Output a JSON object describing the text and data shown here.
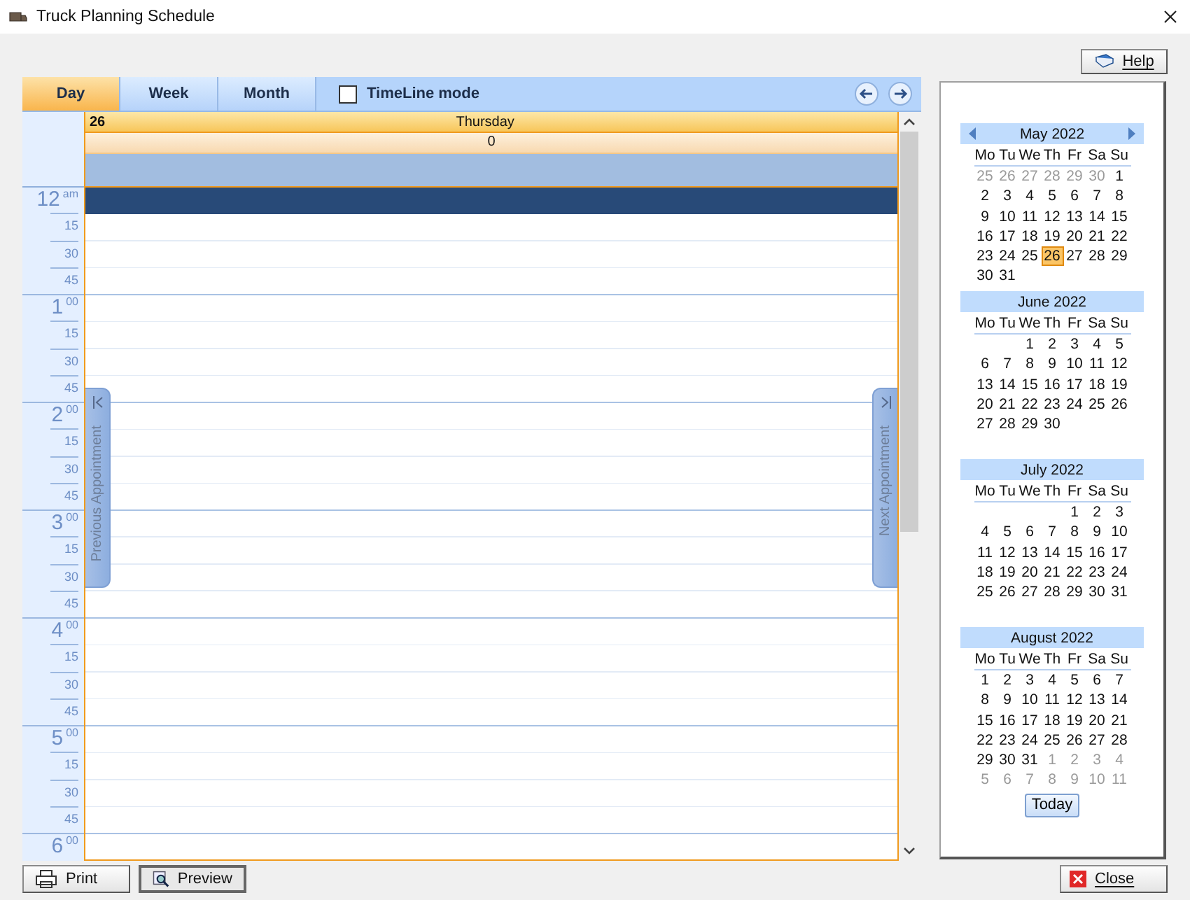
{
  "window": {
    "title": "Truck Planning Schedule"
  },
  "help_button": "Help",
  "view_tabs": [
    {
      "label": "Day",
      "selected": true
    },
    {
      "label": "Week",
      "selected": false
    },
    {
      "label": "Month",
      "selected": false
    }
  ],
  "timeline_mode": {
    "label": "TimeLine mode",
    "checked": false
  },
  "day_header": {
    "date": "26",
    "weekday": "Thursday",
    "count": "0"
  },
  "hours": [
    {
      "hour": "12",
      "suffix": "am",
      "quarters": [
        {
          "selected": true
        },
        {
          "label": "15",
          "selected": false
        },
        {
          "label": "30",
          "selected": false
        },
        {
          "label": "45",
          "selected": false
        }
      ]
    },
    {
      "hour": "1",
      "suffix": "00",
      "quarters": [
        {
          "selected": false
        },
        {
          "label": "15",
          "selected": false
        },
        {
          "label": "30",
          "selected": false
        },
        {
          "label": "45",
          "selected": false
        }
      ]
    },
    {
      "hour": "2",
      "suffix": "00",
      "quarters": [
        {
          "selected": false
        },
        {
          "label": "15",
          "selected": false
        },
        {
          "label": "30",
          "selected": false
        },
        {
          "label": "45",
          "selected": false
        }
      ]
    },
    {
      "hour": "3",
      "suffix": "00",
      "quarters": [
        {
          "selected": false
        },
        {
          "label": "15",
          "selected": false
        },
        {
          "label": "30",
          "selected": false
        },
        {
          "label": "45",
          "selected": false
        }
      ]
    },
    {
      "hour": "4",
      "suffix": "00",
      "quarters": [
        {
          "selected": false
        },
        {
          "label": "15",
          "selected": false
        },
        {
          "label": "30",
          "selected": false
        },
        {
          "label": "45",
          "selected": false
        }
      ]
    },
    {
      "hour": "5",
      "suffix": "00",
      "quarters": [
        {
          "selected": false
        },
        {
          "label": "15",
          "selected": false
        },
        {
          "label": "30",
          "selected": false
        },
        {
          "label": "45",
          "selected": false
        }
      ]
    },
    {
      "hour": "6",
      "suffix": "00",
      "quarters": [
        {
          "selected": false
        }
      ]
    }
  ],
  "previous_appointment": "Previous Appointment",
  "next_appointment": "Next Appointment",
  "months": [
    {
      "title": "May 2022",
      "arrows": true,
      "weekdays": [
        "Mo",
        "Tu",
        "We",
        "Th",
        "Fr",
        "Sa",
        "Su"
      ],
      "weeks": [
        [
          {
            "day": "25",
            "other_month": true,
            "selected": false
          },
          {
            "day": "26",
            "other_month": true,
            "selected": false
          },
          {
            "day": "27",
            "other_month": true,
            "selected": false
          },
          {
            "day": "28",
            "other_month": true,
            "selected": false
          },
          {
            "day": "29",
            "other_month": true,
            "selected": false
          },
          {
            "day": "30",
            "other_month": true,
            "selected": false
          },
          {
            "day": "1",
            "other_month": false,
            "selected": false
          }
        ],
        [
          {
            "day": "2",
            "other_month": false,
            "selected": false
          },
          {
            "day": "3",
            "other_month": false,
            "selected": false
          },
          {
            "day": "4",
            "other_month": false,
            "selected": false
          },
          {
            "day": "5",
            "other_month": false,
            "selected": false
          },
          {
            "day": "6",
            "other_month": false,
            "selected": false
          },
          {
            "day": "7",
            "other_month": false,
            "selected": false
          },
          {
            "day": "8",
            "other_month": false,
            "selected": false
          }
        ],
        [
          {
            "day": "9",
            "other_month": false,
            "selected": false
          },
          {
            "day": "10",
            "other_month": false,
            "selected": false
          },
          {
            "day": "11",
            "other_month": false,
            "selected": false
          },
          {
            "day": "12",
            "other_month": false,
            "selected": false
          },
          {
            "day": "13",
            "other_month": false,
            "selected": false
          },
          {
            "day": "14",
            "other_month": false,
            "selected": false
          },
          {
            "day": "15",
            "other_month": false,
            "selected": false
          }
        ],
        [
          {
            "day": "16",
            "other_month": false,
            "selected": false
          },
          {
            "day": "17",
            "other_month": false,
            "selected": false
          },
          {
            "day": "18",
            "other_month": false,
            "selected": false
          },
          {
            "day": "19",
            "other_month": false,
            "selected": false
          },
          {
            "day": "20",
            "other_month": false,
            "selected": false
          },
          {
            "day": "21",
            "other_month": false,
            "selected": false
          },
          {
            "day": "22",
            "other_month": false,
            "selected": false
          }
        ],
        [
          {
            "day": "23",
            "other_month": false,
            "selected": false
          },
          {
            "day": "24",
            "other_month": false,
            "selected": false
          },
          {
            "day": "25",
            "other_month": false,
            "selected": false
          },
          {
            "day": "26",
            "other_month": false,
            "selected": true
          },
          {
            "day": "27",
            "other_month": false,
            "selected": false
          },
          {
            "day": "28",
            "other_month": false,
            "selected": false
          },
          {
            "day": "29",
            "other_month": false,
            "selected": false
          }
        ],
        [
          {
            "day": "30",
            "other_month": false,
            "selected": false
          },
          {
            "day": "31",
            "other_month": false,
            "selected": false
          }
        ]
      ]
    },
    {
      "title": "June 2022",
      "arrows": false,
      "weekdays": [
        "Mo",
        "Tu",
        "We",
        "Th",
        "Fr",
        "Sa",
        "Su"
      ],
      "weeks": [
        [
          {
            "blank": true
          },
          {
            "blank": true
          },
          {
            "day": "1",
            "other_month": false,
            "selected": false
          },
          {
            "day": "2",
            "other_month": false,
            "selected": false
          },
          {
            "day": "3",
            "other_month": false,
            "selected": false
          },
          {
            "day": "4",
            "other_month": false,
            "selected": false
          },
          {
            "day": "5",
            "other_month": false,
            "selected": false
          }
        ],
        [
          {
            "day": "6",
            "other_month": false,
            "selected": false
          },
          {
            "day": "7",
            "other_month": false,
            "selected": false
          },
          {
            "day": "8",
            "other_month": false,
            "selected": false
          },
          {
            "day": "9",
            "other_month": false,
            "selected": false
          },
          {
            "day": "10",
            "other_month": false,
            "selected": false
          },
          {
            "day": "11",
            "other_month": false,
            "selected": false
          },
          {
            "day": "12",
            "other_month": false,
            "selected": false
          }
        ],
        [
          {
            "day": "13",
            "other_month": false,
            "selected": false
          },
          {
            "day": "14",
            "other_month": false,
            "selected": false
          },
          {
            "day": "15",
            "other_month": false,
            "selected": false
          },
          {
            "day": "16",
            "other_month": false,
            "selected": false
          },
          {
            "day": "17",
            "other_month": false,
            "selected": false
          },
          {
            "day": "18",
            "other_month": false,
            "selected": false
          },
          {
            "day": "19",
            "other_month": false,
            "selected": false
          }
        ],
        [
          {
            "day": "20",
            "other_month": false,
            "selected": false
          },
          {
            "day": "21",
            "other_month": false,
            "selected": false
          },
          {
            "day": "22",
            "other_month": false,
            "selected": false
          },
          {
            "day": "23",
            "other_month": false,
            "selected": false
          },
          {
            "day": "24",
            "other_month": false,
            "selected": false
          },
          {
            "day": "25",
            "other_month": false,
            "selected": false
          },
          {
            "day": "26",
            "other_month": false,
            "selected": false
          }
        ],
        [
          {
            "day": "27",
            "other_month": false,
            "selected": false
          },
          {
            "day": "28",
            "other_month": false,
            "selected": false
          },
          {
            "day": "29",
            "other_month": false,
            "selected": false
          },
          {
            "day": "30",
            "other_month": false,
            "selected": false
          }
        ]
      ]
    },
    {
      "title": "July 2022",
      "arrows": false,
      "weekdays": [
        "Mo",
        "Tu",
        "We",
        "Th",
        "Fr",
        "Sa",
        "Su"
      ],
      "weeks": [
        [
          {
            "blank": true
          },
          {
            "blank": true
          },
          {
            "blank": true
          },
          {
            "blank": true
          },
          {
            "day": "1",
            "other_month": false,
            "selected": false
          },
          {
            "day": "2",
            "other_month": false,
            "selected": false
          },
          {
            "day": "3",
            "other_month": false,
            "selected": false
          }
        ],
        [
          {
            "day": "4",
            "other_month": false,
            "selected": false
          },
          {
            "day": "5",
            "other_month": false,
            "selected": false
          },
          {
            "day": "6",
            "other_month": false,
            "selected": false
          },
          {
            "day": "7",
            "other_month": false,
            "selected": false
          },
          {
            "day": "8",
            "other_month": false,
            "selected": false
          },
          {
            "day": "9",
            "other_month": false,
            "selected": false
          },
          {
            "day": "10",
            "other_month": false,
            "selected": false
          }
        ],
        [
          {
            "day": "11",
            "other_month": false,
            "selected": false
          },
          {
            "day": "12",
            "other_month": false,
            "selected": false
          },
          {
            "day": "13",
            "other_month": false,
            "selected": false
          },
          {
            "day": "14",
            "other_month": false,
            "selected": false
          },
          {
            "day": "15",
            "other_month": false,
            "selected": false
          },
          {
            "day": "16",
            "other_month": false,
            "selected": false
          },
          {
            "day": "17",
            "other_month": false,
            "selected": false
          }
        ],
        [
          {
            "day": "18",
            "other_month": false,
            "selected": false
          },
          {
            "day": "19",
            "other_month": false,
            "selected": false
          },
          {
            "day": "20",
            "other_month": false,
            "selected": false
          },
          {
            "day": "21",
            "other_month": false,
            "selected": false
          },
          {
            "day": "22",
            "other_month": false,
            "selected": false
          },
          {
            "day": "23",
            "other_month": false,
            "selected": false
          },
          {
            "day": "24",
            "other_month": false,
            "selected": false
          }
        ],
        [
          {
            "day": "25",
            "other_month": false,
            "selected": false
          },
          {
            "day": "26",
            "other_month": false,
            "selected": false
          },
          {
            "day": "27",
            "other_month": false,
            "selected": false
          },
          {
            "day": "28",
            "other_month": false,
            "selected": false
          },
          {
            "day": "29",
            "other_month": false,
            "selected": false
          },
          {
            "day": "30",
            "other_month": false,
            "selected": false
          },
          {
            "day": "31",
            "other_month": false,
            "selected": false
          }
        ]
      ]
    },
    {
      "title": "August 2022",
      "arrows": false,
      "weekdays": [
        "Mo",
        "Tu",
        "We",
        "Th",
        "Fr",
        "Sa",
        "Su"
      ],
      "weeks": [
        [
          {
            "day": "1",
            "other_month": false,
            "selected": false
          },
          {
            "day": "2",
            "other_month": false,
            "selected": false
          },
          {
            "day": "3",
            "other_month": false,
            "selected": false
          },
          {
            "day": "4",
            "other_month": false,
            "selected": false
          },
          {
            "day": "5",
            "other_month": false,
            "selected": false
          },
          {
            "day": "6",
            "other_month": false,
            "selected": false
          },
          {
            "day": "7",
            "other_month": false,
            "selected": false
          }
        ],
        [
          {
            "day": "8",
            "other_month": false,
            "selected": false
          },
          {
            "day": "9",
            "other_month": false,
            "selected": false
          },
          {
            "day": "10",
            "other_month": false,
            "selected": false
          },
          {
            "day": "11",
            "other_month": false,
            "selected": false
          },
          {
            "day": "12",
            "other_month": false,
            "selected": false
          },
          {
            "day": "13",
            "other_month": false,
            "selected": false
          },
          {
            "day": "14",
            "other_month": false,
            "selected": false
          }
        ],
        [
          {
            "day": "15",
            "other_month": false,
            "selected": false
          },
          {
            "day": "16",
            "other_month": false,
            "selected": false
          },
          {
            "day": "17",
            "other_month": false,
            "selected": false
          },
          {
            "day": "18",
            "other_month": false,
            "selected": false
          },
          {
            "day": "19",
            "other_month": false,
            "selected": false
          },
          {
            "day": "20",
            "other_month": false,
            "selected": false
          },
          {
            "day": "21",
            "other_month": false,
            "selected": false
          }
        ],
        [
          {
            "day": "22",
            "other_month": false,
            "selected": false
          },
          {
            "day": "23",
            "other_month": false,
            "selected": false
          },
          {
            "day": "24",
            "other_month": false,
            "selected": false
          },
          {
            "day": "25",
            "other_month": false,
            "selected": false
          },
          {
            "day": "26",
            "other_month": false,
            "selected": false
          },
          {
            "day": "27",
            "other_month": false,
            "selected": false
          },
          {
            "day": "28",
            "other_month": false,
            "selected": false
          }
        ],
        [
          {
            "day": "29",
            "other_month": false,
            "selected": false
          },
          {
            "day": "30",
            "other_month": false,
            "selected": false
          },
          {
            "day": "31",
            "other_month": false,
            "selected": false
          },
          {
            "day": "1",
            "other_month": true,
            "selected": false
          },
          {
            "day": "2",
            "other_month": true,
            "selected": false
          },
          {
            "day": "3",
            "other_month": true,
            "selected": false
          },
          {
            "day": "4",
            "other_month": true,
            "selected": false
          }
        ],
        [
          {
            "day": "5",
            "other_month": true,
            "selected": false
          },
          {
            "day": "6",
            "other_month": true,
            "selected": false
          },
          {
            "day": "7",
            "other_month": true,
            "selected": false
          },
          {
            "day": "8",
            "other_month": true,
            "selected": false
          },
          {
            "day": "9",
            "other_month": true,
            "selected": false
          },
          {
            "day": "10",
            "other_month": true,
            "selected": false
          },
          {
            "day": "11",
            "other_month": true,
            "selected": false
          }
        ]
      ]
    }
  ],
  "today_button": "Today",
  "bottom_buttons": [
    {
      "kind": "print",
      "label": "Print"
    },
    {
      "kind": "preview",
      "label": "Preview"
    }
  ],
  "close_button": "Close"
}
